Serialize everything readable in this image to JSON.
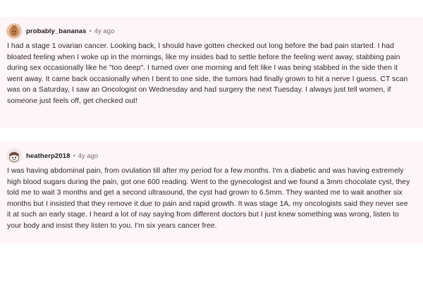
{
  "comments": [
    {
      "username": "probably_bananas",
      "separator": "•",
      "time": "4y ago",
      "text": "I had a stage 1 ovarian cancer. Looking back, I should have gotten checked out long before the bad pain started. I had bloated feeling when I woke up in the mornings, like my insides bad to settle before the feeling went away, stabbing pain during sex occasionally like he \"too deep\". I turned over one morning and felt like I was being stabbed in the side then it went away. It came back occasionally when I bent to one side, the tumors had finally grown to hit a nerve I guess. CT scan was on a Saturday, I saw an Oncologist on Wednesday and had surgery the next Tuesday. I always just tell women, if someone just feels off, get checked out!",
      "avatar_icon": "snoo-avatar-icon",
      "avatar_color": "#c98b5a"
    },
    {
      "username": "heatherp2018",
      "separator": "•",
      "time": "4y ago",
      "text": "I was having abdominal pain, from ovulation till after my period for a few months. I'm a diabetic and was having extremely high blood sugars during the pain, got one 600 reading. Went to the gynecologist and we found a 3mm chocolate cyst, they told me to wait 3 months and get a second ultrasound, the cyst had grown to 6.5mm. They wanted me to wait another six months but I insisted that they remove it due to pain and rapid growth. It was stage 1A, my oncologists said they never see it at such an early stage. I heard a lot of nay saying from different doctors but I just knew something was wrong, listen to your body and insist they listen to you. I'm six years cancer free.",
      "avatar_icon": "snoo-avatar-icon",
      "avatar_color": "#6b4b3a"
    }
  ],
  "colors": {
    "comment_background": "#fdf5f8",
    "text": "#2a2a2a",
    "meta": "#7a6a75"
  }
}
